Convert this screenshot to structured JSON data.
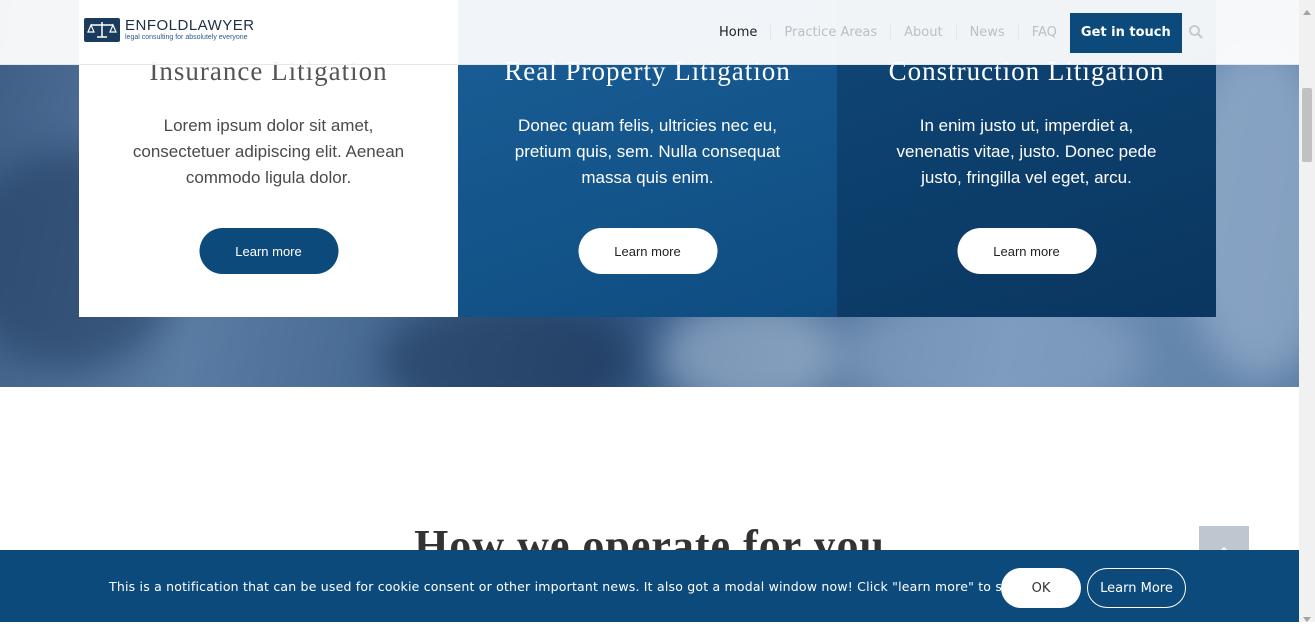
{
  "header": {
    "logo": {
      "name": "ENFOLDLAWYER",
      "tagline": "legal consulting for absolutely everyone"
    },
    "nav": [
      {
        "label": "Home"
      },
      {
        "label": "Practice Areas"
      },
      {
        "label": "About"
      },
      {
        "label": "News"
      },
      {
        "label": "FAQ"
      }
    ],
    "cta_label": "Get in touch",
    "search_icon": "search-icon"
  },
  "cards": [
    {
      "title": "Insurance Litigation",
      "text": "Lorem ipsum dolor sit amet, consectetuer adipiscing elit. Aenean commodo ligula dolor.",
      "button": "Learn more"
    },
    {
      "title": "Real Property Litigation",
      "text": "Donec quam felis, ultricies nec eu, pretium quis, sem. Nulla consequat massa quis enim.",
      "button": "Learn more"
    },
    {
      "title": "Construction Litigation",
      "text": "In enim justo ut, imperdiet a, venenatis vitae, justo. Donec pede justo, fringilla vel eget, arcu.",
      "button": "Learn more"
    }
  ],
  "section": {
    "heading": "How we operate for you"
  },
  "cookie": {
    "message": "This is a notification that can be used for cookie consent or other important news. It also got a modal window now! Click \"learn more\" to see it!",
    "ok_label": "OK",
    "more_label": "Learn More"
  },
  "colors": {
    "brand": "#0d4a7c",
    "card_mid": "#1a5f97",
    "card_dark": "#0f4676"
  }
}
